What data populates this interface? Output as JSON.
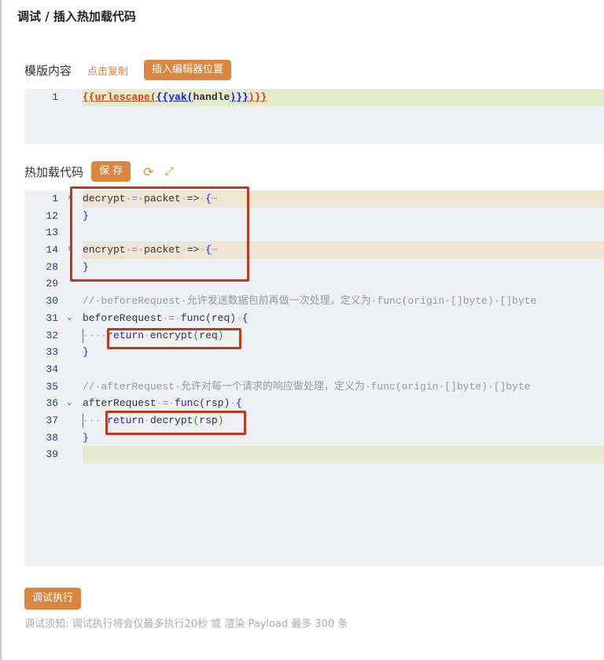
{
  "title": "调试 / 插入热加载代码",
  "template": {
    "label": "模版内容",
    "copy_link": "点击复制",
    "insert_button": "插入编辑器位置",
    "lines": [
      {
        "n": "1",
        "tokens": [
          [
            "tp",
            "{{urlescape("
          ],
          [
            "tb",
            "{{yak("
          ],
          [
            "hd",
            "handle"
          ],
          [
            "tb",
            ")}}"
          ],
          [
            "tp",
            ")}}"
          ]
        ]
      }
    ]
  },
  "hotload": {
    "label": "热加载代码",
    "save_button": "保 存",
    "refresh_icon": "sync-icon",
    "fullscreen_icon": "expand-icon",
    "lines": [
      {
        "n": "1",
        "fold": "›",
        "hl": "fold",
        "tokens": [
          [
            "id",
            "decrypt"
          ],
          [
            "ws",
            "·"
          ],
          [
            "op",
            "="
          ],
          [
            "ws",
            "·"
          ],
          [
            "id",
            "packet"
          ],
          [
            "ws",
            "·"
          ],
          [
            "id",
            "=>"
          ],
          [
            "ws",
            "·"
          ],
          [
            "br",
            "{"
          ],
          [
            "ws",
            "⋯"
          ]
        ]
      },
      {
        "n": "12",
        "tokens": [
          [
            "br",
            "}"
          ]
        ]
      },
      {
        "n": "13",
        "tokens": []
      },
      {
        "n": "14",
        "fold": "›",
        "hl": "fold",
        "tokens": [
          [
            "id",
            "encrypt"
          ],
          [
            "ws",
            "·"
          ],
          [
            "op",
            "="
          ],
          [
            "ws",
            "·"
          ],
          [
            "id",
            "packet"
          ],
          [
            "ws",
            "·"
          ],
          [
            "id",
            "=>"
          ],
          [
            "ws",
            "·"
          ],
          [
            "br",
            "{"
          ],
          [
            "ws",
            "⋯"
          ]
        ]
      },
      {
        "n": "28",
        "tokens": [
          [
            "br",
            "}"
          ]
        ]
      },
      {
        "n": "29",
        "tokens": []
      },
      {
        "n": "30",
        "tokens": [
          [
            "cm",
            "//·beforeRequest·允许发送数据包前再做一次处理，定义为·func(origin·[]byte)·[]byte"
          ]
        ]
      },
      {
        "n": "31",
        "fold": "⌄",
        "tokens": [
          [
            "id",
            "beforeRequest"
          ],
          [
            "ws",
            "·"
          ],
          [
            "op",
            "="
          ],
          [
            "ws",
            "·"
          ],
          [
            "kw",
            "func"
          ],
          [
            "id",
            "(req)"
          ],
          [
            "ws",
            "·"
          ],
          [
            "br",
            "{"
          ]
        ]
      },
      {
        "n": "32",
        "guide": true,
        "tokens": [
          [
            "ws",
            "····"
          ],
          [
            "kw",
            "return"
          ],
          [
            "ws",
            "·"
          ],
          [
            "id",
            "encrypt"
          ],
          [
            "pg",
            "("
          ],
          [
            "id",
            "req"
          ],
          [
            "pg",
            ")"
          ]
        ]
      },
      {
        "n": "33",
        "tokens": [
          [
            "br",
            "}"
          ]
        ]
      },
      {
        "n": "34",
        "tokens": []
      },
      {
        "n": "35",
        "tokens": [
          [
            "cm",
            "//·afterRequest·允许对每一个请求的响应做处理，定义为·func(origin·[]byte)·[]byte"
          ]
        ]
      },
      {
        "n": "36",
        "fold": "⌄",
        "tokens": [
          [
            "id",
            "afterRequest"
          ],
          [
            "ws",
            "·"
          ],
          [
            "op",
            "="
          ],
          [
            "ws",
            "·"
          ],
          [
            "kw",
            "func"
          ],
          [
            "id",
            "(rsp)"
          ],
          [
            "ws",
            "·"
          ],
          [
            "br",
            "{"
          ]
        ]
      },
      {
        "n": "37",
        "guide": true,
        "tokens": [
          [
            "ws",
            "···"
          ],
          [
            "ws",
            " "
          ],
          [
            "kw",
            "return"
          ],
          [
            "ws",
            "·"
          ],
          [
            "id",
            "decrypt"
          ],
          [
            "pg",
            "("
          ],
          [
            "id",
            "rsp"
          ],
          [
            "pg",
            ")"
          ]
        ]
      },
      {
        "n": "38",
        "tokens": [
          [
            "br",
            "}"
          ]
        ]
      },
      {
        "n": "39",
        "hl": "cur",
        "tokens": []
      }
    ]
  },
  "debug_button": "调试执行",
  "note": "调试须知: 调试执行将会仅最多执行20秒 或 渲染 Payload 最多 300 条",
  "colors": {
    "accent": "#d9873f",
    "annotation": "#c0391b"
  }
}
